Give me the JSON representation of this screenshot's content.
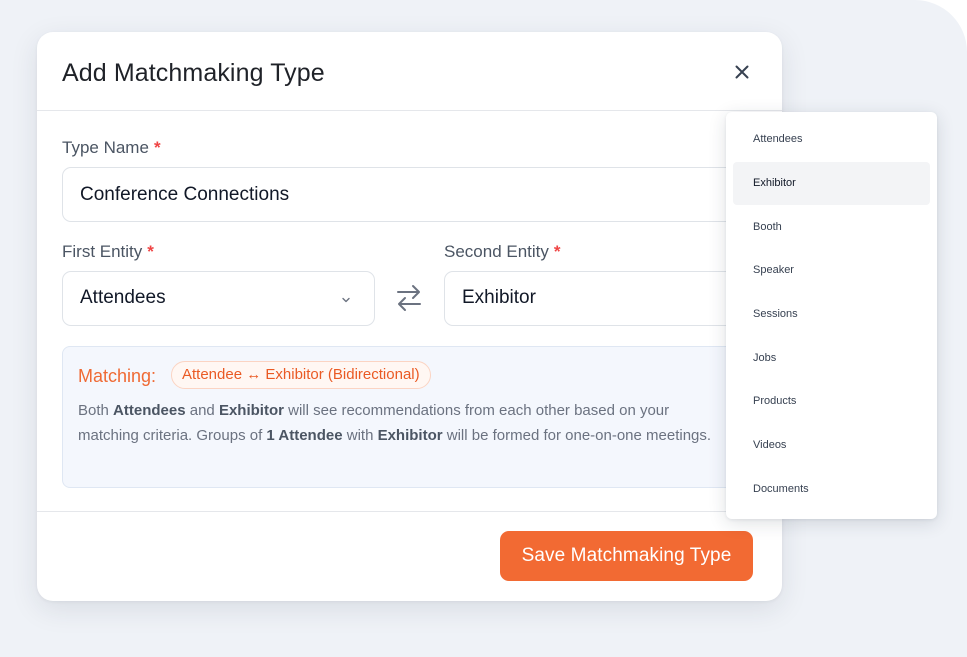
{
  "modal": {
    "title": "Add Matchmaking Type"
  },
  "form": {
    "type_name_label": "Type Name",
    "type_name_value": "Conference Connections",
    "first_entity_label": "First Entity",
    "first_entity_value": "Attendees",
    "second_entity_label": "Second Entity",
    "second_entity_value": "Exhibitor",
    "required_marker": "*"
  },
  "matching": {
    "label": "Matching:",
    "pill": "Attendee ↔ Exhibitor (Bidirectional)",
    "desc_1": "Both ",
    "entity_a": "Attendees",
    "desc_2": " and ",
    "entity_b": "Exhibitor",
    "desc_3": " will see recommendations from each other based on your matching criteria. Groups of ",
    "group_a": "1 Attendee",
    "desc_4": " with ",
    "group_b": "Exhibitor",
    "desc_5": " will be formed for one-on-one meetings."
  },
  "footer": {
    "save_label": "Save Matchmaking Type"
  },
  "dropdown": {
    "selected": "Exhibitor",
    "items": [
      {
        "label": "Attendees"
      },
      {
        "label": "Exhibitor"
      },
      {
        "label": "Booth"
      },
      {
        "label": "Speaker"
      },
      {
        "label": "Sessions"
      },
      {
        "label": "Jobs"
      },
      {
        "label": "Products"
      },
      {
        "label": "Videos"
      },
      {
        "label": "Documents"
      }
    ]
  },
  "icons": {
    "close": "close-icon",
    "chevron": "chevron-down-icon",
    "swap": "swap-arrows-icon"
  },
  "colors": {
    "accent": "#f26a33",
    "required": "#ef4444",
    "info_bg": "#f4f7fd"
  }
}
